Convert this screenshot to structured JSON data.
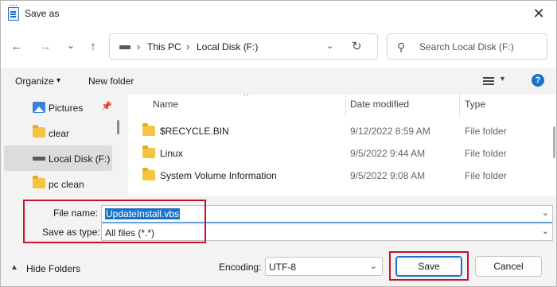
{
  "window": {
    "title": "Save as",
    "close_glyph": "✕"
  },
  "nav": {
    "back_glyph": "←",
    "forward_glyph": "→",
    "recent_glyph": "⌄",
    "up_glyph": "↑",
    "separator_glyph": "›",
    "breadcrumbs": [
      "This PC",
      "Local Disk (F:)"
    ],
    "dropdown_glyph": "⌄",
    "refresh_glyph": "↻",
    "search_placeholder": "Search Local Disk (F:)",
    "search_glyph": "⚲"
  },
  "toolbar": {
    "organize": "Organize",
    "organize_caret": "▾",
    "new_folder": "New folder",
    "view_caret": "▾",
    "help_glyph": "?"
  },
  "sidebar": {
    "items": [
      {
        "label": "Pictures",
        "icon": "pictures-icon",
        "pinned": true
      },
      {
        "label": "clear",
        "icon": "folder-icon"
      },
      {
        "label": "Local Disk (F:)",
        "icon": "drive-icon",
        "selected": true
      },
      {
        "label": "pc clean",
        "icon": "folder-icon"
      }
    ],
    "pin_glyph": "📌"
  },
  "files": {
    "columns": {
      "name": "Name",
      "date": "Date modified",
      "type": "Type",
      "sort_glyph": "⌃"
    },
    "rows": [
      {
        "name": "$RECYCLE.BIN",
        "date": "9/12/2022 8:59 AM",
        "type": "File folder"
      },
      {
        "name": "Linux",
        "date": "9/5/2022 9:44 AM",
        "type": "File folder"
      },
      {
        "name": "System Volume Information",
        "date": "9/5/2022 9:08 AM",
        "type": "File folder"
      }
    ]
  },
  "form": {
    "file_name_label": "File name:",
    "file_name_value": "UpdateInstall.vbs",
    "save_type_label": "Save as type:",
    "save_type_value": "All files  (*.*)",
    "dropdown_glyph": "⌄",
    "hide_folders": "Hide Folders",
    "hide_caret": "▲",
    "encoding_label": "Encoding:",
    "encoding_value": "UTF-8",
    "save_button": "Save",
    "cancel_button": "Cancel"
  },
  "colors": {
    "accent": "#1a73c9",
    "highlight_box": "#c8102e",
    "folder": "#f5c443"
  }
}
